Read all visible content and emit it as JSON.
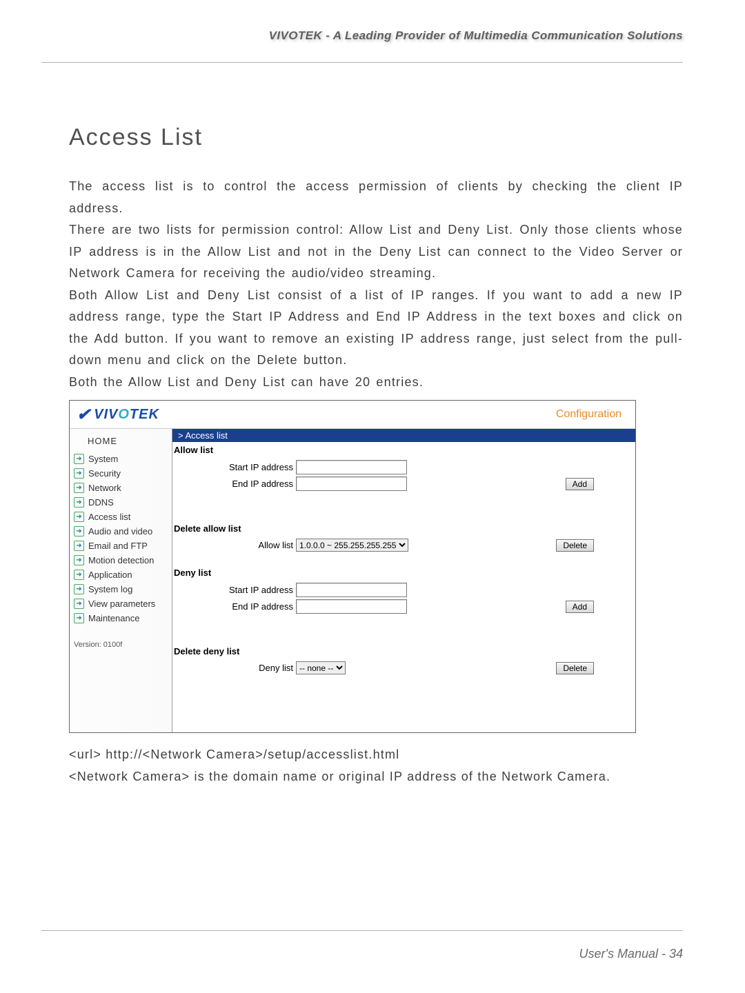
{
  "header": {
    "tagline": "VIVOTEK - A Leading Provider of Multimedia Communication Solutions"
  },
  "title": "Access List",
  "para1": "The access list is to control the access permission of clients by checking the client IP address.",
  "para2": "There are two lists for permission control: Allow List and Deny List. Only those clients whose IP address is in the Allow List and not in the Deny List can connect to the Video Server or Network Camera for receiving the audio/video streaming.",
  "para3": "Both Allow List and Deny List consist of a list of IP ranges. If you want to add a new IP address range, type the Start IP Address and End IP Address in the text boxes and click on the Add button. If you want to remove an existing IP address range, just select from the pull-down menu and click on the Delete button.",
  "para4": "Both the Allow List and Deny List can have 20 entries.",
  "screenshot": {
    "logo": "VIVOTEK",
    "config": "Configuration",
    "sidebar": {
      "home": "HOME",
      "items": [
        "System",
        "Security",
        "Network",
        "DDNS",
        "Access list",
        "Audio and video",
        "Email and FTP",
        "Motion detection",
        "Application",
        "System log",
        "View parameters",
        "Maintenance"
      ],
      "version": "Version: 0100f"
    },
    "main": {
      "crumb": "> Access list",
      "allow": {
        "title": "Allow list",
        "start": "Start IP address",
        "end": "End IP address",
        "add": "Add"
      },
      "delallow": {
        "title": "Delete allow list",
        "label": "Allow list",
        "option": "1.0.0.0 ~ 255.255.255.255",
        "delete": "Delete"
      },
      "deny": {
        "title": "Deny list",
        "start": "Start IP address",
        "end": "End IP address",
        "add": "Add"
      },
      "deldeny": {
        "title": "Delete deny list",
        "label": "Deny list",
        "option": "-- none --",
        "delete": "Delete"
      }
    }
  },
  "post1": "<url> http://<Network Camera>/setup/accesslist.html",
  "post2": "<Network Camera> is the domain name or original IP address of the Network Camera.",
  "footer": "User's Manual - 34"
}
